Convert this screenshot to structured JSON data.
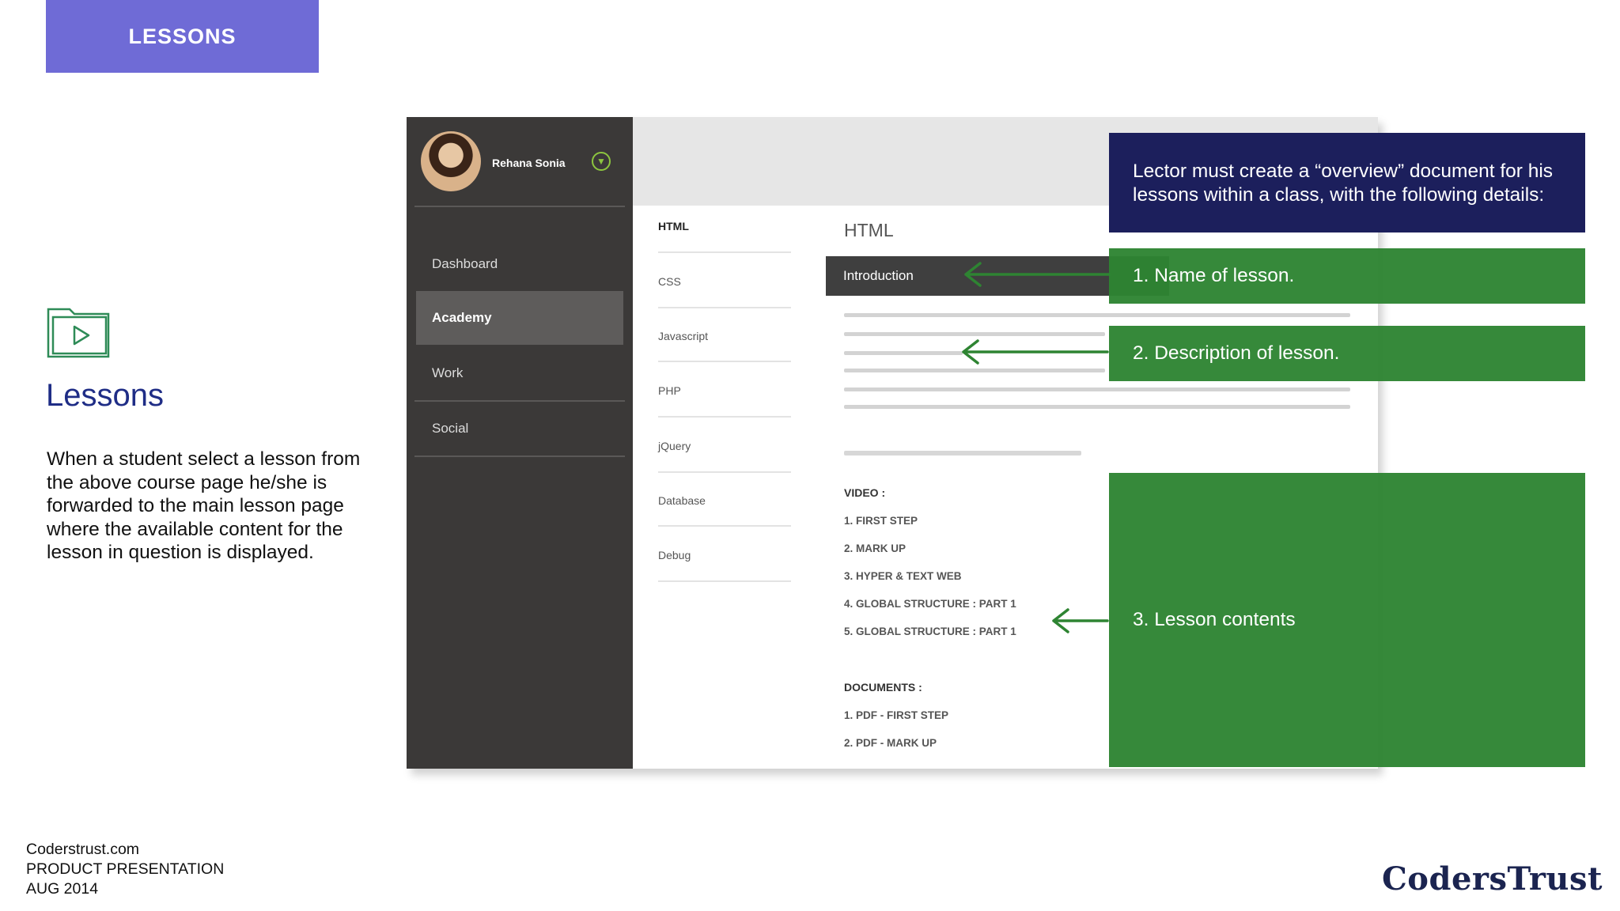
{
  "slide": {
    "badge": "LESSONS",
    "heading": "Lessons",
    "description": "When a student  select a lesson from the above course page he/she is forwarded to the main lesson page where the available content  for the lesson in question  is displayed.",
    "footer": [
      "Coderstrust.com",
      "PRODUCT PRESENTATION",
      "AUG 2014"
    ],
    "brand": "CodersTrust",
    "icon": "folder-play-icon"
  },
  "mock": {
    "user_name": "Rehana Sonia",
    "sidebar": [
      "Dashboard",
      "Academy",
      "Work",
      "Social"
    ],
    "active_sidebar": "Academy",
    "subnav": [
      "HTML",
      "CSS",
      "Javascript",
      "PHP",
      "jQuery",
      "Database",
      "Debug"
    ],
    "content_title": "HTML",
    "selected_lesson": "Introduction",
    "video_heading": "VIDEO :",
    "videos": [
      "1. FIRST STEP",
      "2. MARK UP",
      "3. HYPER & TEXT WEB",
      "4. GLOBAL STRUCTURE : PART 1",
      "5. GLOBAL STRUCTURE : PART 1"
    ],
    "documents_heading": "DOCUMENTS :",
    "documents": [
      "1. PDF - FIRST STEP",
      "2. PDF - MARK UP"
    ],
    "colors": {
      "sidebar": "#3b3938",
      "accent": "#8dc63f"
    }
  },
  "notes": {
    "intro": "Lector must create a “overview” document for his lessons within a class, with the following details:",
    "name": "1. Name of lesson.",
    "description": "2. Description of lesson.",
    "contents": "3. Lesson contents",
    "colors": {
      "dark": "#1c1f5c",
      "green": "#2e8432",
      "badge": "#6f6bd6"
    }
  }
}
